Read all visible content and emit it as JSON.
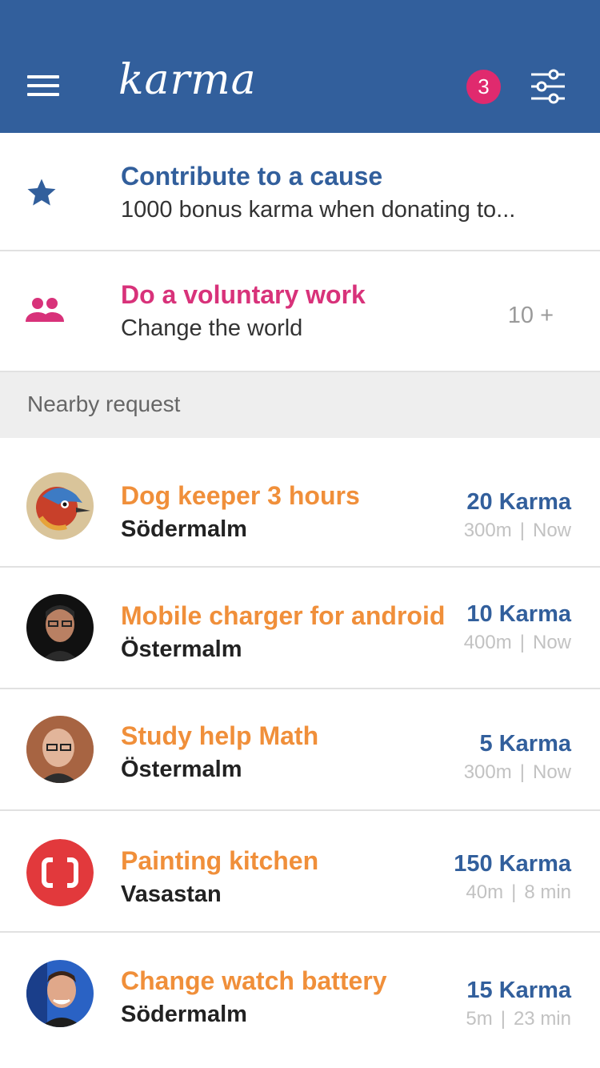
{
  "appbar": {
    "logo_text": "karma",
    "notification_count": "3"
  },
  "causes": [
    {
      "title": "Contribute to a cause",
      "subtitle": "1000 bonus karma when donating to...",
      "icon": "star-icon"
    },
    {
      "title": "Do a voluntary work",
      "subtitle": "Change the world",
      "count": "10 +",
      "icon": "people-icon"
    }
  ],
  "section": {
    "label": "Nearby request"
  },
  "requests": [
    {
      "title": "Dog keeper 3 hours",
      "location": "Södermalm",
      "karma": "20 Karma",
      "distance": "300m",
      "time": "Now"
    },
    {
      "title": "Mobile charger for android",
      "location": "Östermalm",
      "karma": "10 Karma",
      "distance": "400m",
      "time": "Now"
    },
    {
      "title": "Study help Math",
      "location": "Östermalm",
      "karma": "5 Karma",
      "distance": "300m",
      "time": "Now"
    },
    {
      "title": "Painting kitchen",
      "location": "Vasastan",
      "karma": "150 Karma",
      "distance": "40m",
      "time": "8 min"
    },
    {
      "title": "Change watch battery",
      "location": "Södermalm",
      "karma": "15 Karma",
      "distance": "5m",
      "time": "23 min"
    }
  ],
  "colors": {
    "primary": "#325f9c",
    "accent_pink": "#d8327a",
    "badge": "#e02a6e",
    "orange": "#f08f3a"
  }
}
